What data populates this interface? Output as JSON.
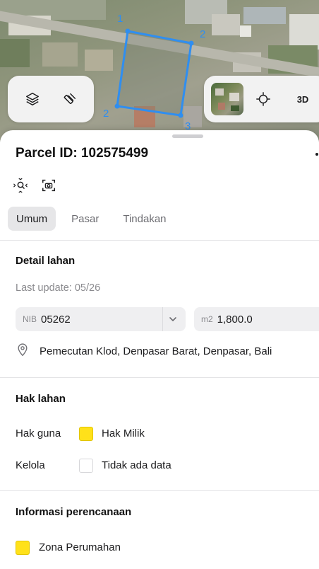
{
  "map": {
    "parcel_edge_labels": [
      "1",
      "2",
      "2",
      "3"
    ],
    "controls": {
      "layers_icon": "layers-icon",
      "draw_icon": "ruler-pencil-icon",
      "basemap_icon": "satellite-thumbnail",
      "locate_icon": "crosshair-icon",
      "mode_3d_label": "3D"
    }
  },
  "colors": {
    "parcel_outline": "#2f8ef0",
    "yellow_swatch": "#ffe11a",
    "tab_active_bg": "#e6e6e8"
  },
  "sheet": {
    "title": "Parcel ID: 102575499",
    "tools": [
      "zoom-to-parcel-icon",
      "camera-capture-icon"
    ],
    "tabs": [
      {
        "label": "Umum",
        "active": true
      },
      {
        "label": "Pasar",
        "active": false
      },
      {
        "label": "Tindakan",
        "active": false
      }
    ],
    "detail": {
      "title": "Detail lahan",
      "last_update": "Last update: 05/26",
      "nib_prefix": "NIB",
      "nib_value": "05262",
      "area_prefix": "m2",
      "area_value": "1,800.0",
      "address": "Pemecutan Klod, Denpasar Barat, Denpasar, Bali"
    },
    "rights": {
      "title": "Hak lahan",
      "rows": [
        {
          "label": "Hak guna",
          "value": "Hak Milik",
          "swatch": "yellow"
        },
        {
          "label": "Kelola",
          "value": "Tidak ada data",
          "swatch": "empty"
        }
      ]
    },
    "planning": {
      "title": "Informasi perencanaan",
      "zone": "Zona Perumahan",
      "zone_swatch": "yellow"
    }
  }
}
